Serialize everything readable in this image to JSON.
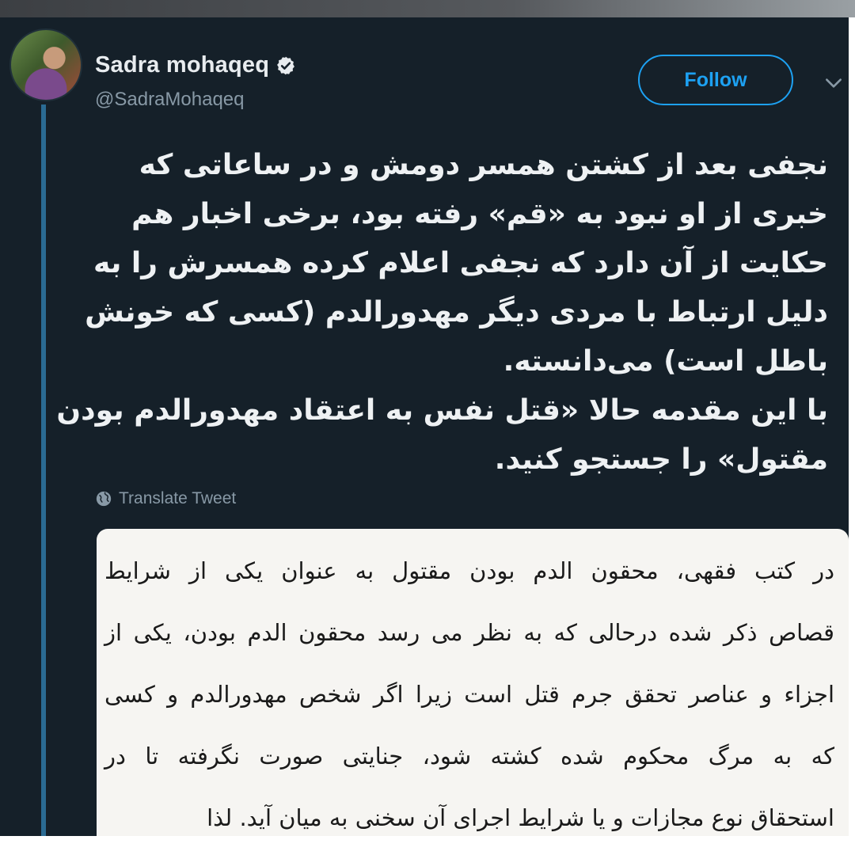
{
  "author": {
    "display_name": "Sadra mohaqeq",
    "handle": "@SadraMohaqeq",
    "verified": true,
    "avatar_icon": "user-avatar"
  },
  "actions": {
    "follow_label": "Follow",
    "menu_icon": "chevron-down-icon"
  },
  "tweet": {
    "lines": [
      "نجفی بعد از کشتن همسر دومش و در ساعاتی که",
      "خبری از او نبود به «قم» رفته بود، برخی اخبار هم",
      "حکایت از آن دارد که نجفی اعلام کرده همسرش را به",
      "دلیل ارتباط با مردی دیگر مهدورالدم (کسی که خونش",
      "باطل است) می‌دانسته.",
      "با این مقدمه حالا «قتل نفس به اعتقاد مهدورالدم بودن",
      "مقتول» را جستجو کنید."
    ],
    "translate_label": "Translate Tweet"
  },
  "quoted_image": {
    "lines": [
      "در کتب فقهی، محقون الدم بودن مقتول به عنوان یکی از شرایط",
      "قصاص ذکر شده درحالی که به نظر می رسد محقون الدم بودن، یکی از",
      "اجزاء و عناصر تحقق جرم قتل است زیرا اگر شخص مهدورالدم و کسی",
      "که به مرگ محکوم شده کشته شود، جنایتی صورت نگرفته تا در",
      "استحقاق نوع مجازات و یا شرایط اجرای آن سخنی به میان آید. لذا"
    ]
  },
  "colors": {
    "background": "#152029",
    "accent": "#1da1f2",
    "thread_line": "#2b6b93",
    "secondary_text": "#8899a6"
  }
}
